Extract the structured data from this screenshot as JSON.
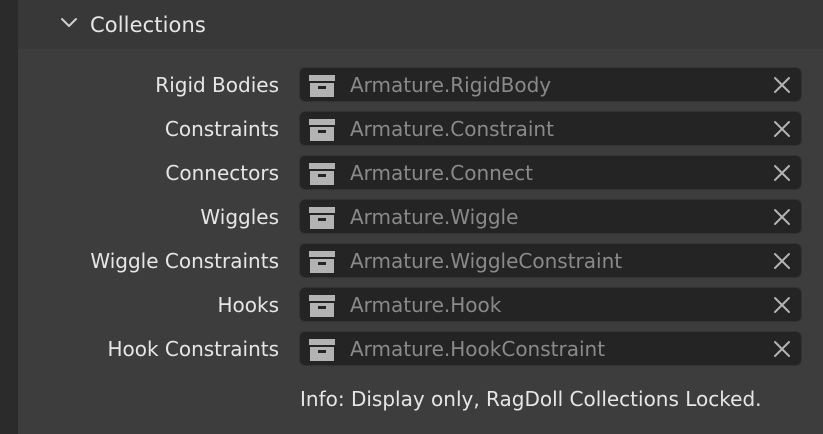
{
  "panel": {
    "title": "Collections",
    "expanded": true
  },
  "rows": [
    {
      "label": "Rigid Bodies",
      "value": "Armature.RigidBody"
    },
    {
      "label": "Constraints",
      "value": "Armature.Constraint"
    },
    {
      "label": "Connectors",
      "value": "Armature.Connect"
    },
    {
      "label": "Wiggles",
      "value": "Armature.Wiggle"
    },
    {
      "label": "Wiggle Constraints",
      "value": "Armature.WiggleConstraint"
    },
    {
      "label": "Hooks",
      "value": "Armature.Hook"
    },
    {
      "label": "Hook Constraints",
      "value": "Armature.HookConstraint"
    }
  ],
  "info": "Info: Display only, RagDoll Collections Locked.",
  "icons": {
    "expand": "chevron-down-icon",
    "collection": "collection-box-icon",
    "clear": "close-icon"
  },
  "colors": {
    "panel_bg": "#3d3d3d",
    "field_bg": "#242424",
    "text": "#e6e6e6",
    "value_text": "#8a8a8a",
    "icon": "#b3b3b3"
  }
}
